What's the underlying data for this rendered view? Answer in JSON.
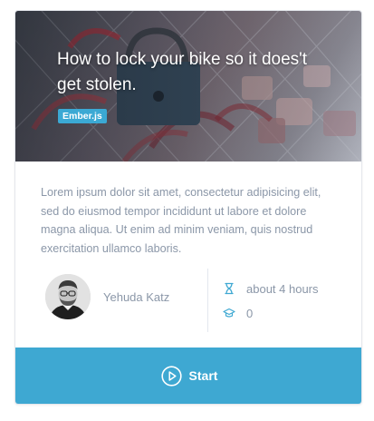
{
  "card": {
    "title": "How to lock your bike so it does't get stolen.",
    "tag": "Ember.js",
    "description": "Lorem ipsum dolor sit amet, consectetur adipisicing elit, sed do eiusmod tempor incididunt ut labore et dolore magna aliqua. Ut enim ad minim veniam, quis nostrud exercitation ullamco laboris.",
    "author": {
      "name": "Yehuda Katz"
    },
    "stats": {
      "duration": "about 4 hours",
      "duration_icon": "hourglass-icon",
      "students": "0",
      "students_icon": "graduation-cap-icon"
    },
    "action": {
      "label": "Start",
      "icon": "play-circle-icon"
    }
  },
  "colors": {
    "accent": "#3ea8d2",
    "tag": "#3ba9d4",
    "text_muted": "#8b97a8"
  }
}
